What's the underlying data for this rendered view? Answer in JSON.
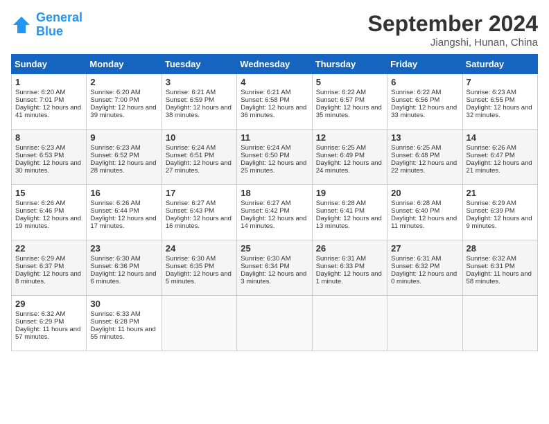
{
  "header": {
    "logo_line1": "General",
    "logo_line2": "Blue",
    "month": "September 2024",
    "location": "Jiangshi, Hunan, China"
  },
  "days_of_week": [
    "Sunday",
    "Monday",
    "Tuesday",
    "Wednesday",
    "Thursday",
    "Friday",
    "Saturday"
  ],
  "weeks": [
    [
      {
        "day": "1",
        "sunrise": "Sunrise: 6:20 AM",
        "sunset": "Sunset: 7:01 PM",
        "daylight": "Daylight: 12 hours and 41 minutes."
      },
      {
        "day": "2",
        "sunrise": "Sunrise: 6:20 AM",
        "sunset": "Sunset: 7:00 PM",
        "daylight": "Daylight: 12 hours and 39 minutes."
      },
      {
        "day": "3",
        "sunrise": "Sunrise: 6:21 AM",
        "sunset": "Sunset: 6:59 PM",
        "daylight": "Daylight: 12 hours and 38 minutes."
      },
      {
        "day": "4",
        "sunrise": "Sunrise: 6:21 AM",
        "sunset": "Sunset: 6:58 PM",
        "daylight": "Daylight: 12 hours and 36 minutes."
      },
      {
        "day": "5",
        "sunrise": "Sunrise: 6:22 AM",
        "sunset": "Sunset: 6:57 PM",
        "daylight": "Daylight: 12 hours and 35 minutes."
      },
      {
        "day": "6",
        "sunrise": "Sunrise: 6:22 AM",
        "sunset": "Sunset: 6:56 PM",
        "daylight": "Daylight: 12 hours and 33 minutes."
      },
      {
        "day": "7",
        "sunrise": "Sunrise: 6:23 AM",
        "sunset": "Sunset: 6:55 PM",
        "daylight": "Daylight: 12 hours and 32 minutes."
      }
    ],
    [
      {
        "day": "8",
        "sunrise": "Sunrise: 6:23 AM",
        "sunset": "Sunset: 6:53 PM",
        "daylight": "Daylight: 12 hours and 30 minutes."
      },
      {
        "day": "9",
        "sunrise": "Sunrise: 6:23 AM",
        "sunset": "Sunset: 6:52 PM",
        "daylight": "Daylight: 12 hours and 28 minutes."
      },
      {
        "day": "10",
        "sunrise": "Sunrise: 6:24 AM",
        "sunset": "Sunset: 6:51 PM",
        "daylight": "Daylight: 12 hours and 27 minutes."
      },
      {
        "day": "11",
        "sunrise": "Sunrise: 6:24 AM",
        "sunset": "Sunset: 6:50 PM",
        "daylight": "Daylight: 12 hours and 25 minutes."
      },
      {
        "day": "12",
        "sunrise": "Sunrise: 6:25 AM",
        "sunset": "Sunset: 6:49 PM",
        "daylight": "Daylight: 12 hours and 24 minutes."
      },
      {
        "day": "13",
        "sunrise": "Sunrise: 6:25 AM",
        "sunset": "Sunset: 6:48 PM",
        "daylight": "Daylight: 12 hours and 22 minutes."
      },
      {
        "day": "14",
        "sunrise": "Sunrise: 6:26 AM",
        "sunset": "Sunset: 6:47 PM",
        "daylight": "Daylight: 12 hours and 21 minutes."
      }
    ],
    [
      {
        "day": "15",
        "sunrise": "Sunrise: 6:26 AM",
        "sunset": "Sunset: 6:46 PM",
        "daylight": "Daylight: 12 hours and 19 minutes."
      },
      {
        "day": "16",
        "sunrise": "Sunrise: 6:26 AM",
        "sunset": "Sunset: 6:44 PM",
        "daylight": "Daylight: 12 hours and 17 minutes."
      },
      {
        "day": "17",
        "sunrise": "Sunrise: 6:27 AM",
        "sunset": "Sunset: 6:43 PM",
        "daylight": "Daylight: 12 hours and 16 minutes."
      },
      {
        "day": "18",
        "sunrise": "Sunrise: 6:27 AM",
        "sunset": "Sunset: 6:42 PM",
        "daylight": "Daylight: 12 hours and 14 minutes."
      },
      {
        "day": "19",
        "sunrise": "Sunrise: 6:28 AM",
        "sunset": "Sunset: 6:41 PM",
        "daylight": "Daylight: 12 hours and 13 minutes."
      },
      {
        "day": "20",
        "sunrise": "Sunrise: 6:28 AM",
        "sunset": "Sunset: 6:40 PM",
        "daylight": "Daylight: 12 hours and 11 minutes."
      },
      {
        "day": "21",
        "sunrise": "Sunrise: 6:29 AM",
        "sunset": "Sunset: 6:39 PM",
        "daylight": "Daylight: 12 hours and 9 minutes."
      }
    ],
    [
      {
        "day": "22",
        "sunrise": "Sunrise: 6:29 AM",
        "sunset": "Sunset: 6:37 PM",
        "daylight": "Daylight: 12 hours and 8 minutes."
      },
      {
        "day": "23",
        "sunrise": "Sunrise: 6:30 AM",
        "sunset": "Sunset: 6:36 PM",
        "daylight": "Daylight: 12 hours and 6 minutes."
      },
      {
        "day": "24",
        "sunrise": "Sunrise: 6:30 AM",
        "sunset": "Sunset: 6:35 PM",
        "daylight": "Daylight: 12 hours and 5 minutes."
      },
      {
        "day": "25",
        "sunrise": "Sunrise: 6:30 AM",
        "sunset": "Sunset: 6:34 PM",
        "daylight": "Daylight: 12 hours and 3 minutes."
      },
      {
        "day": "26",
        "sunrise": "Sunrise: 6:31 AM",
        "sunset": "Sunset: 6:33 PM",
        "daylight": "Daylight: 12 hours and 1 minute."
      },
      {
        "day": "27",
        "sunrise": "Sunrise: 6:31 AM",
        "sunset": "Sunset: 6:32 PM",
        "daylight": "Daylight: 12 hours and 0 minutes."
      },
      {
        "day": "28",
        "sunrise": "Sunrise: 6:32 AM",
        "sunset": "Sunset: 6:31 PM",
        "daylight": "Daylight: 11 hours and 58 minutes."
      }
    ],
    [
      {
        "day": "29",
        "sunrise": "Sunrise: 6:32 AM",
        "sunset": "Sunset: 6:29 PM",
        "daylight": "Daylight: 11 hours and 57 minutes."
      },
      {
        "day": "30",
        "sunrise": "Sunrise: 6:33 AM",
        "sunset": "Sunset: 6:28 PM",
        "daylight": "Daylight: 11 hours and 55 minutes."
      },
      {
        "day": "",
        "sunrise": "",
        "sunset": "",
        "daylight": ""
      },
      {
        "day": "",
        "sunrise": "",
        "sunset": "",
        "daylight": ""
      },
      {
        "day": "",
        "sunrise": "",
        "sunset": "",
        "daylight": ""
      },
      {
        "day": "",
        "sunrise": "",
        "sunset": "",
        "daylight": ""
      },
      {
        "day": "",
        "sunrise": "",
        "sunset": "",
        "daylight": ""
      }
    ]
  ]
}
